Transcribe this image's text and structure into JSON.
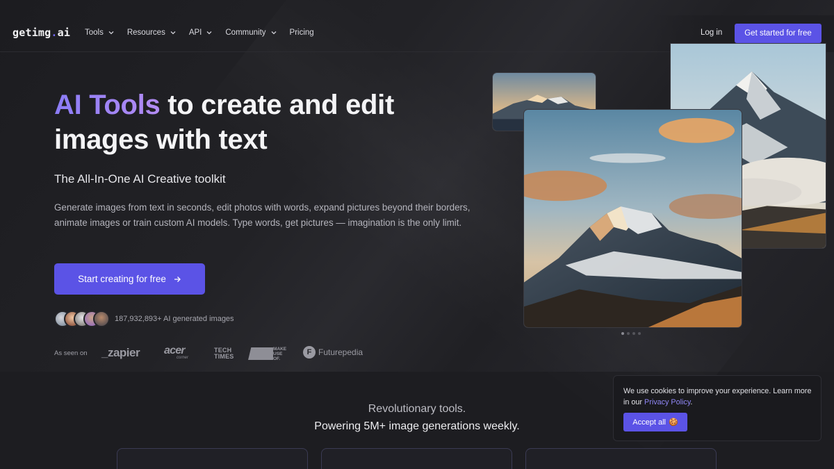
{
  "nav": {
    "logo_main": "getimg",
    "logo_dot": ".",
    "logo_tld": "ai",
    "links": [
      {
        "label": "Tools",
        "has_dropdown": true
      },
      {
        "label": "Resources",
        "has_dropdown": true
      },
      {
        "label": "API",
        "has_dropdown": true
      },
      {
        "label": "Community",
        "has_dropdown": true
      },
      {
        "label": "Pricing",
        "has_dropdown": false
      }
    ],
    "login_label": "Log in",
    "cta_label": "Get started for free"
  },
  "hero": {
    "headline_accent": "AI Tools",
    "headline_rest_1": " to create and edit",
    "headline_rest_2": "images with text",
    "subheadline": "The All-In-One AI Creative toolkit",
    "description": "Generate images from text in seconds, edit photos with words, expand pictures beyond their borders, animate images or train custom AI models. Type words, get pictures — imagination is the only limit.",
    "cta_label": "Start creating for free",
    "cta_icon": "arrow-right-icon",
    "generated_count": "187,932,893+ AI generated images",
    "as_seen_on": "As seen on",
    "brands": {
      "zapier": "_zapier",
      "acer": "acer",
      "acer_sub": "corner",
      "techtimes_1": "TECH",
      "techtimes_2": "TIMES",
      "makeuseof_1": "MAKE",
      "makeuseof_2": "USE",
      "makeuseof_3": "OF.",
      "futurepedia_icon": "F",
      "futurepedia": "Futurepedia"
    }
  },
  "gallery": {
    "images": [
      "mountain-small-thumbnail",
      "mountain-main-image",
      "mountain-right-image"
    ],
    "carousel_dots": 4,
    "active_dot": 0
  },
  "section": {
    "title": "Revolutionary tools.",
    "subtitle": "Powering 5M+ image generations weekly."
  },
  "cookie": {
    "text_before": "We use cookies to improve your experience. Learn more in our ",
    "link_label": "Privacy Policy",
    "text_after": ".",
    "accept_label": "Accept all",
    "accept_icon": "🍪"
  },
  "colors": {
    "accent": "#5b53e6",
    "background": "#1d1d21",
    "headline_accent_start": "#8b7cf6",
    "headline_accent_end": "#b38cf3"
  }
}
